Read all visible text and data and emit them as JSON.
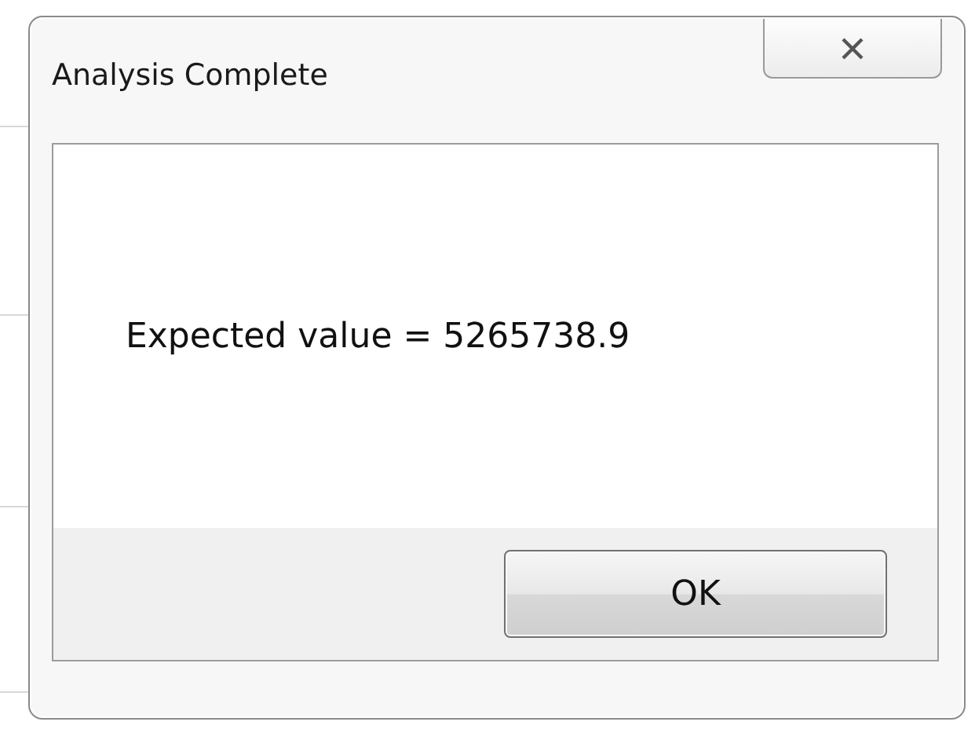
{
  "window": {
    "title": "Analysis Complete"
  },
  "message": "Expected value = 5265738.9",
  "buttons": [
    {
      "label": "OK"
    }
  ]
}
